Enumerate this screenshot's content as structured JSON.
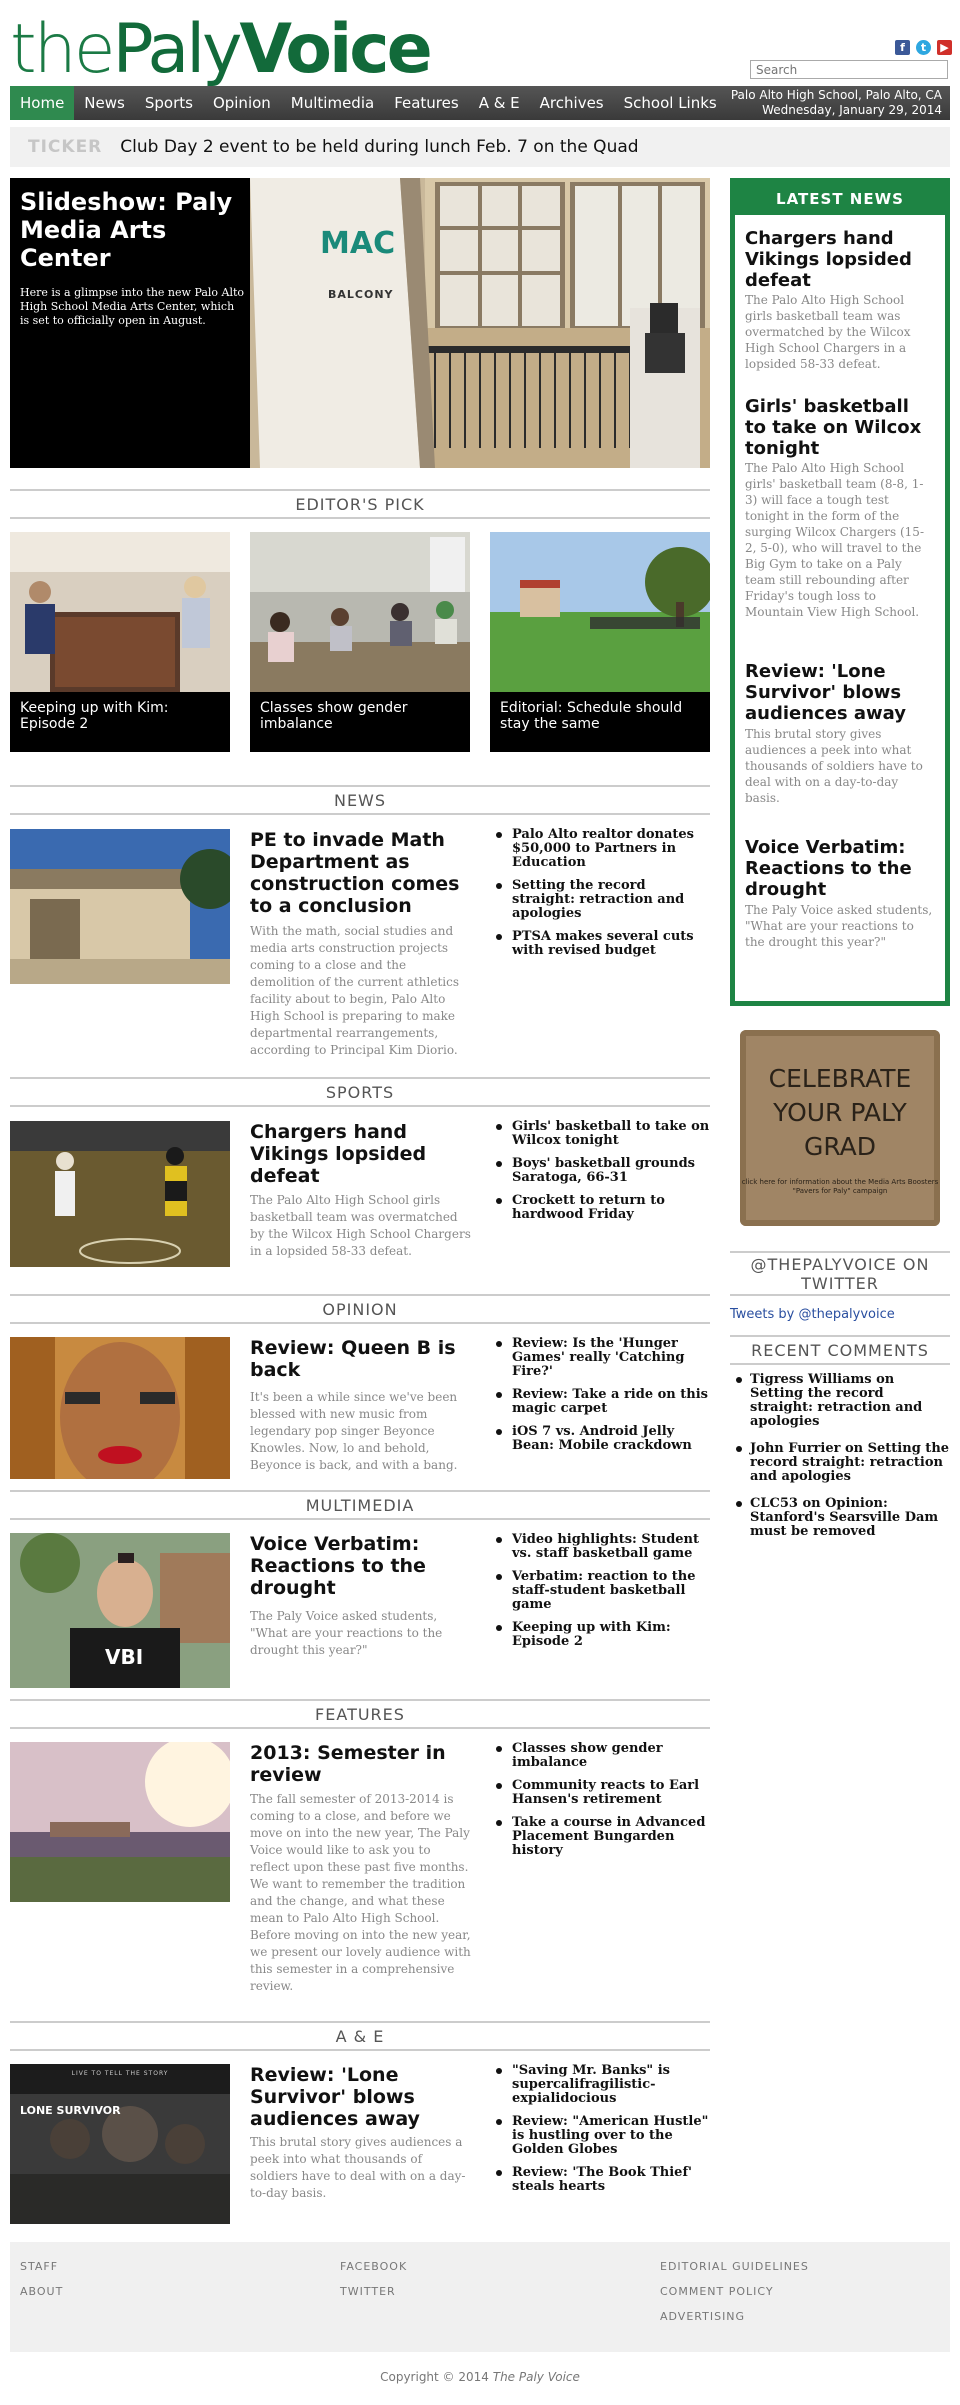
{
  "site": {
    "logo_parts": [
      "the",
      "Paly",
      "Voice"
    ],
    "search_placeholder": "Search",
    "location": "Palo Alto High School, Palo Alto, CA",
    "date": "Wednesday, January 29, 2014",
    "social_icons": [
      "facebook-icon",
      "twitter-icon",
      "youtube-icon"
    ],
    "brand_color": "#1e8444"
  },
  "nav": [
    "Home",
    "News",
    "Sports",
    "Opinion",
    "Multimedia",
    "Features",
    "A & E",
    "Archives",
    "School Links"
  ],
  "ticker": {
    "label": "TICKER",
    "text": "Club Day 2 event to be held during lunch Feb. 7 on the Quad"
  },
  "slideshow": {
    "title": "Slideshow: Paly Media Arts Center",
    "desc": "Here is a glimpse into the new Palo Alto High School Media Arts Center, which is set to officially open in August.",
    "sign_title": "MAC",
    "sign_sub": "BALCONY"
  },
  "editors_pick": {
    "heading": "EDITOR'S PICK",
    "items": [
      "Keeping up with Kim: Episode 2",
      "Classes show gender imbalance",
      "Editorial: Schedule should stay the same"
    ]
  },
  "sections": [
    {
      "heading": "NEWS",
      "title": "PE to invade Math Department as construction comes to a conclusion",
      "desc": "With the math, social studies and media arts construction projects coming to a close and the demolition of the current athletics facility about to begin, Palo Alto High School is preparing to make departmental rearrangements, according to Principal Kim Diorio.",
      "links": [
        "Palo Alto realtor donates $50,000 to Partners in Education",
        "Setting the record straight: retraction and apologies",
        "PTSA makes several cuts with revised budget"
      ]
    },
    {
      "heading": "SPORTS",
      "title": "Chargers hand Vikings lopsided defeat",
      "desc": "The Palo Alto High School girls basketball team was overmatched by the Wilcox High School Chargers in a lopsided 58-33 defeat.",
      "links": [
        "Girls' basketball to take on Wilcox tonight",
        "Boys' basketball grounds Saratoga, 66-31",
        "Crockett to return to hardwood Friday"
      ]
    },
    {
      "heading": "OPINION",
      "title": "Review: Queen B is back",
      "desc": "It's been a while since we've been blessed with new music from legendary pop singer Beyonce Knowles. Now, lo and behold, Beyonce is back, and with a bang.",
      "links": [
        "Review: Is the 'Hunger Games' really 'Catching Fire?'",
        "Review: Take a ride on this magic carpet",
        "iOS 7 vs. Android Jelly Bean: Mobile crackdown"
      ]
    },
    {
      "heading": "MULTIMEDIA",
      "title": "Voice Verbatim: Reactions to the drought",
      "desc": "The Paly Voice asked students, \"What are your reactions to the drought this year?\"",
      "links": [
        "Video highlights: Student vs. staff basketball game",
        "Verbatim: reaction to the staff-student basketball game",
        "Keeping up with Kim: Episode 2"
      ],
      "shirt": "VBI"
    },
    {
      "heading": "FEATURES",
      "title": "2013: Semester in review",
      "desc": "The fall semester of 2013-2014 is coming to a close, and before we move on into the new year, The Paly Voice would like to ask you to reflect upon these past five months. We want to remember the tradition and the change, and what these mean to Palo Alto High School. Before moving on into the new year, we present our lovely audience with this semester in a comprehensive review.",
      "links": [
        "Classes show gender imbalance",
        "Community reacts to Earl Hansen's retirement",
        "Take a course in Advanced Placement Bungarden history"
      ]
    },
    {
      "heading": "A & E",
      "title": "Review: 'Lone Survivor' blows audiences away",
      "desc": "This brutal story gives audiences a peek into what thousands of soldiers have to deal with on a day-to-day basis.",
      "links": [
        "\"Saving Mr. Banks\" is supercalifragilistic-expialidocious",
        "Review: \"American Hustle\" is hustling over to the Golden Globes",
        "Review: 'The Book Thief' steals hearts"
      ],
      "poster_tag": "LIVE TO TELL THE STORY",
      "poster_title": "LONE SURVIVOR"
    }
  ],
  "sidebar": {
    "latest_heading": "LATEST NEWS",
    "latest": [
      {
        "title": "Chargers hand Vikings lopsided defeat",
        "desc": "The Palo Alto High School girls basketball team was overmatched by the Wilcox High School Chargers in a lopsided 58-33 defeat."
      },
      {
        "title": "Girls' basketball to take on Wilcox tonight",
        "desc": "The Palo Alto High School girls' basketball team (8-8, 1-3) will face a tough test tonight in the form of the surging Wilcox Chargers (15-2, 5-0), who will travel to the Big Gym to take on a Paly team still rebounding after Friday's tough loss to Mountain View High School."
      },
      {
        "title": "Review: 'Lone Survivor' blows audiences away",
        "desc": "This brutal story gives audiences a peek into what thousands of soldiers have to deal with on a day-to-day basis."
      },
      {
        "title": "Voice Verbatim: Reactions to the drought",
        "desc": "The Paly Voice asked students, \"What are your reactions to the drought this year?\""
      }
    ],
    "grad_ad": {
      "text": "CELEBRATE YOUR PALY GRAD",
      "small": "click here for information about the Media Arts Boosters \"Pavers for Paly\" campaign"
    },
    "twitter_heading": "@THEPALYVOICE ON TWITTER",
    "twitter_link": "Tweets by @thepalyvoice",
    "comments_heading": "RECENT COMMENTS",
    "comments": [
      "Tigress Williams on Setting the record straight: retraction and apologies",
      "John Furrier on Setting the record straight: retraction and apologies",
      "CLC53 on Opinion: Stanford's Searsville Dam must be removed"
    ]
  },
  "footer": {
    "col1": [
      "STAFF",
      "ABOUT"
    ],
    "col2": [
      "FACEBOOK",
      "TWITTER"
    ],
    "col3": [
      "EDITORIAL GUIDELINES",
      "COMMENT POLICY",
      "ADVERTISING"
    ],
    "copyright": "Copyright © 2014",
    "copyright_name": "The Paly Voice"
  }
}
